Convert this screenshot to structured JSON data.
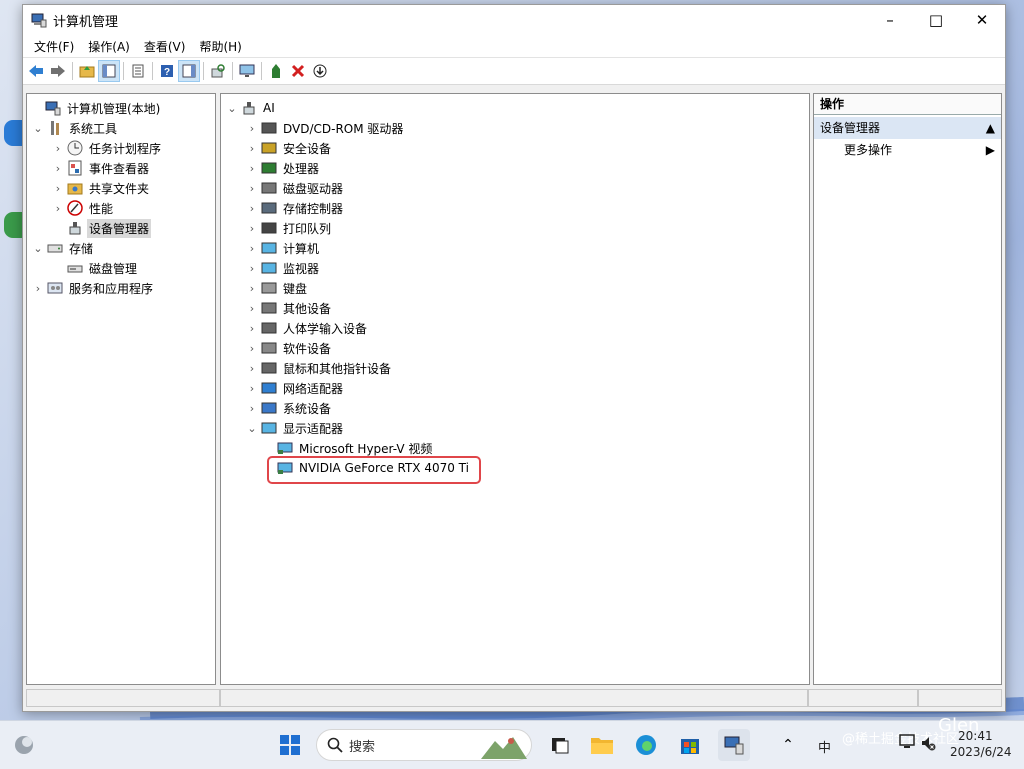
{
  "window": {
    "title": "计算机管理"
  },
  "menu": [
    "文件(F)",
    "操作(A)",
    "查看(V)",
    "帮助(H)"
  ],
  "left_tree": {
    "root": "计算机管理(本地)",
    "system_tools": "系统工具",
    "task_scheduler": "任务计划程序",
    "event_viewer": "事件查看器",
    "shared_folders": "共享文件夹",
    "performance": "性能",
    "device_manager": "设备管理器",
    "storage": "存储",
    "disk_management": "磁盘管理",
    "services_apps": "服务和应用程序"
  },
  "device_tree": {
    "root": "AI",
    "categories": [
      "DVD/CD-ROM 驱动器",
      "安全设备",
      "处理器",
      "磁盘驱动器",
      "存储控制器",
      "打印队列",
      "计算机",
      "监视器",
      "键盘",
      "其他设备",
      "人体学输入设备",
      "软件设备",
      "鼠标和其他指针设备",
      "网络适配器",
      "系统设备",
      "显示适配器"
    ],
    "display_adapters": [
      "Microsoft Hyper-V 视频",
      "NVIDIA GeForce RTX 4070 Ti"
    ]
  },
  "actions": {
    "header": "操作",
    "section": "设备管理器",
    "more": "更多操作"
  },
  "taskbar": {
    "search_placeholder": "搜索",
    "time": "20:41",
    "date": "2023/6/24",
    "ime": "中",
    "watermark": "@稀土掘金技术社区",
    "watermark_name": "Glen"
  },
  "colors": {
    "highlight_box": "#e0464a",
    "selection": "#d9d9d9",
    "action_section_bg": "#dbe6f4"
  }
}
